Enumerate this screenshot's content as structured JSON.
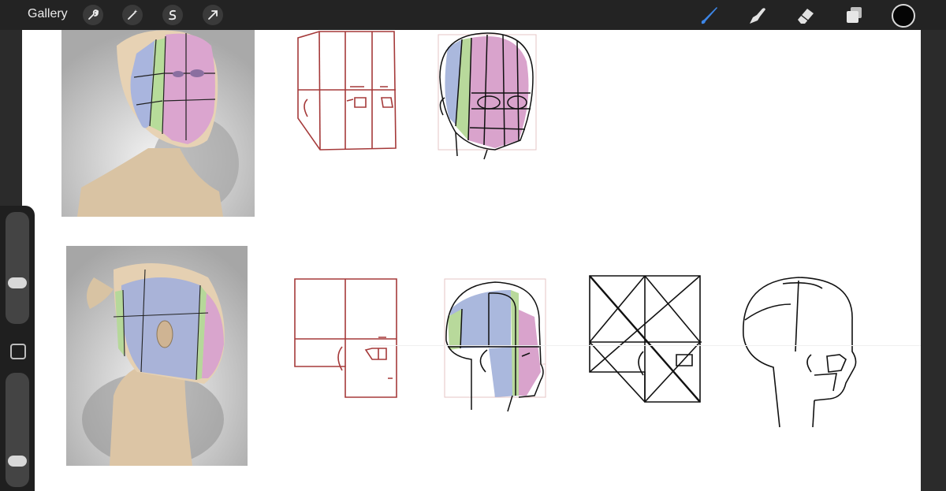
{
  "toolbar": {
    "gallery_label": "Gallery",
    "left_tools": [
      "wrench-icon",
      "magic-wand-icon",
      "selection-icon",
      "transform-arrow-icon"
    ],
    "right_tools": [
      "brush-icon",
      "smudge-icon",
      "eraser-icon",
      "layers-icon"
    ],
    "active_tool": "brush-icon",
    "current_color": "#050505"
  },
  "sidebar": {
    "brush_size_level": 0.35,
    "opacity_level": 0.2
  },
  "colors": {
    "construction_red": "#a53a3a",
    "plane_pink": "#d9a3cc",
    "plane_green": "#b8d99b",
    "plane_blue": "#aab8dd",
    "skin": "#e3cdb0"
  }
}
